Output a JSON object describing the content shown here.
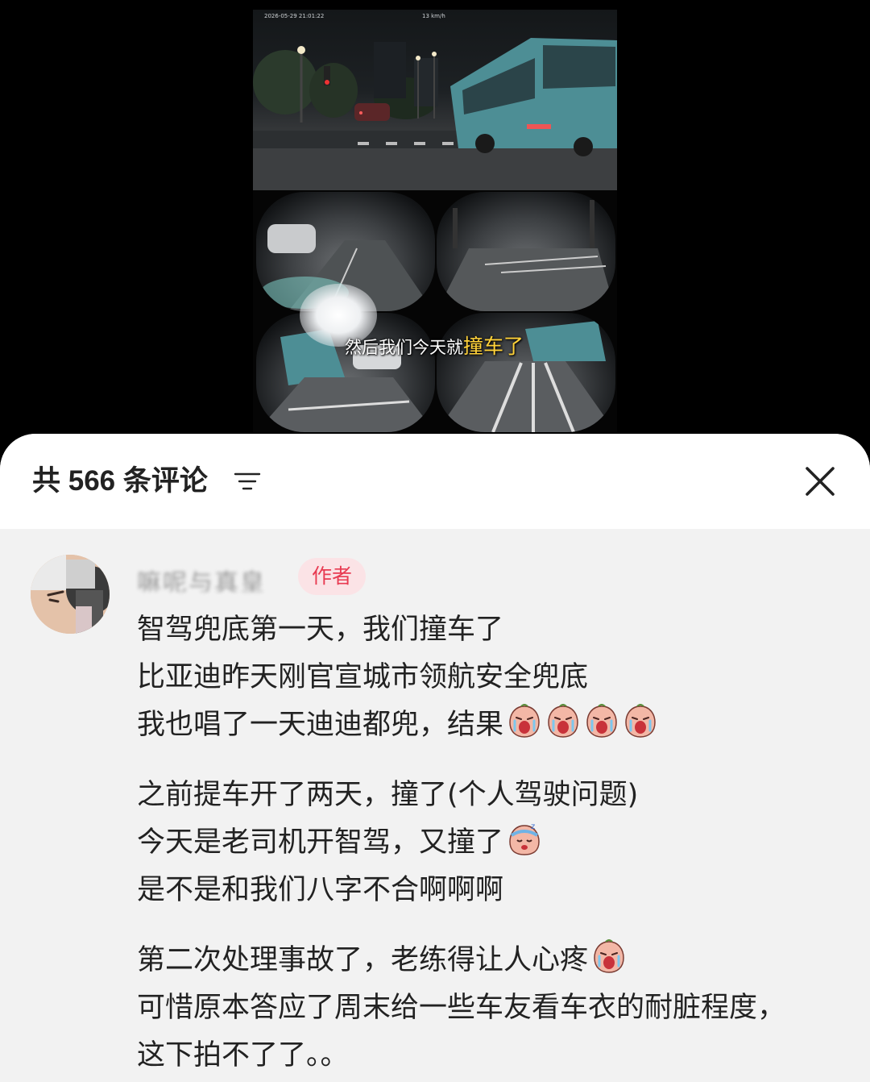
{
  "video": {
    "timestamp": "2026-05-29 21:01:22",
    "speed": "13 km/h",
    "subtitle_prefix": "然后我们今天就",
    "subtitle_highlight": "撞车了"
  },
  "comments_header": {
    "count_label": "共 566 条评论"
  },
  "comment": {
    "author_name": "嘛呢与真皇",
    "author_badge": "作者",
    "lines": [
      "智驾兜底第一天，我们撞车了",
      "比亚迪昨天刚官宣城市领航安全兜底",
      "我也唱了一天迪迪都兜，结果",
      "之前提车开了两天，撞了(个人驾驶问题)",
      "今天是老司机开智驾，又撞了",
      "是不是和我们八字不合啊啊啊",
      "第二次处理事故了，老练得让人心疼",
      "可惜原本答应了周末给一些车友看车衣的耐脏程度，",
      "这下拍不了了。。"
    ],
    "emoji_names": [
      "crying-peach-emoji",
      "sleepy-peach-emoji"
    ]
  },
  "colors": {
    "badge_text": "#e83b52",
    "badge_bg": "#fbe3e6",
    "subtitle_highlight": "#ffd23a",
    "sheet_bg": "#f2f2f2"
  }
}
